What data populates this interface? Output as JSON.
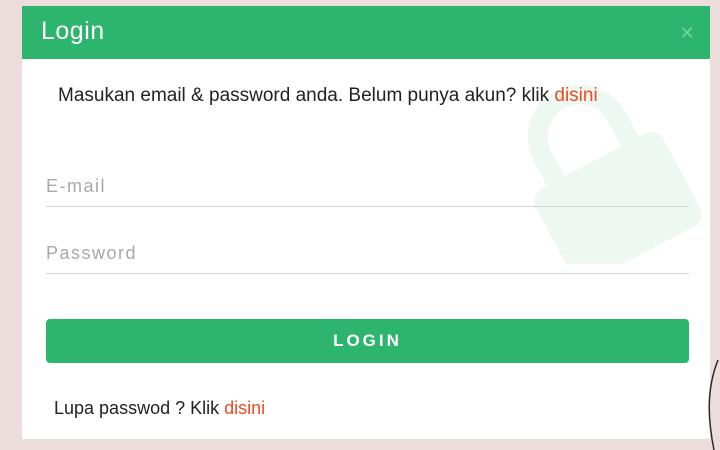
{
  "modal": {
    "title": "Login",
    "close_icon": "close-icon",
    "intro_text": "Masukan email & password anda. Belum punya akun? klik ",
    "intro_link": "disini",
    "email_placeholder": "E-mail",
    "password_placeholder": "Password",
    "login_label": "LOGIN",
    "forgot_text": "Lupa passwod ? Klik ",
    "forgot_link": "disini"
  },
  "colors": {
    "header_bg": "#2db56e",
    "button_bg": "#2db56e",
    "link": "#ee4b1f",
    "page_bg": "#ecdcdc"
  },
  "icons": {
    "watermark": "lock-icon",
    "close": "close-icon"
  }
}
